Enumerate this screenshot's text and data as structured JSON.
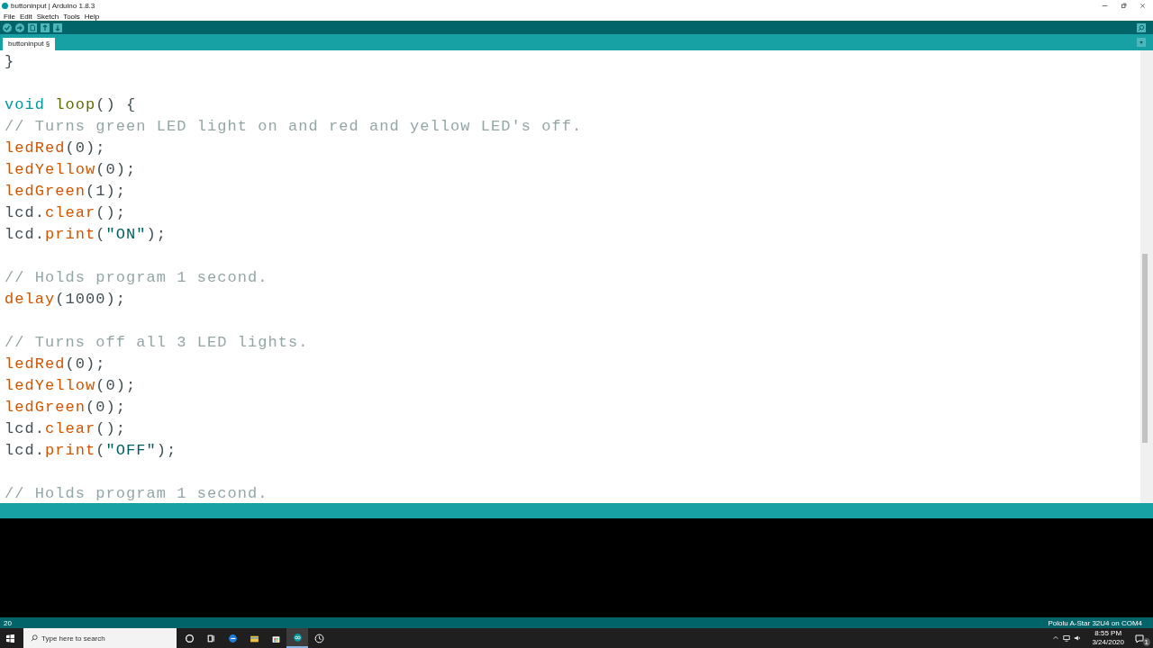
{
  "window": {
    "title": "buttoninput | Arduino 1.8.3"
  },
  "menu": [
    "File",
    "Edit",
    "Sketch",
    "Tools",
    "Help"
  ],
  "toolbar": [
    {
      "kind": "verify"
    },
    {
      "kind": "upload"
    },
    {
      "kind": "new"
    },
    {
      "kind": "open"
    },
    {
      "kind": "save"
    }
  ],
  "tabs": [
    {
      "label": "buttoninput §",
      "selected": true
    }
  ],
  "editor": {
    "lines": [
      {
        "kind": "code",
        "tokens": [
          {
            "text": "}",
            "kind": "plain"
          }
        ]
      },
      {
        "kind": "blank"
      },
      {
        "kind": "code",
        "tokens": [
          {
            "text": "void ",
            "kind": "keyword"
          },
          {
            "text": "loop",
            "kind": "function"
          },
          {
            "text": "() {",
            "kind": "plain"
          }
        ]
      },
      {
        "kind": "code",
        "tokens": [
          {
            "text": "// Turns green LED light on and red and yellow LED's off.",
            "kind": "comment"
          }
        ]
      },
      {
        "kind": "code",
        "tokens": [
          {
            "text": "ledRed",
            "kind": "builtin"
          },
          {
            "text": "(0);",
            "kind": "plain"
          }
        ]
      },
      {
        "kind": "code",
        "tokens": [
          {
            "text": "ledYellow",
            "kind": "builtin"
          },
          {
            "text": "(0);",
            "kind": "plain"
          }
        ]
      },
      {
        "kind": "code",
        "tokens": [
          {
            "text": "ledGreen",
            "kind": "builtin"
          },
          {
            "text": "(1);",
            "kind": "plain"
          }
        ]
      },
      {
        "kind": "code",
        "tokens": [
          {
            "text": "lcd.",
            "kind": "plain"
          },
          {
            "text": "clear",
            "kind": "builtin"
          },
          {
            "text": "();",
            "kind": "plain"
          }
        ]
      },
      {
        "kind": "code",
        "tokens": [
          {
            "text": "lcd.",
            "kind": "plain"
          },
          {
            "text": "print",
            "kind": "builtin"
          },
          {
            "text": "(",
            "kind": "plain"
          },
          {
            "text": "\"ON\"",
            "kind": "string"
          },
          {
            "text": ");",
            "kind": "plain"
          }
        ]
      },
      {
        "kind": "blank"
      },
      {
        "kind": "code",
        "tokens": [
          {
            "text": "// Holds program 1 second.",
            "kind": "comment"
          }
        ]
      },
      {
        "kind": "code",
        "tokens": [
          {
            "text": "delay",
            "kind": "builtin"
          },
          {
            "text": "(1000);",
            "kind": "plain"
          }
        ]
      },
      {
        "kind": "blank"
      },
      {
        "kind": "code",
        "tokens": [
          {
            "text": "// Turns off all 3 LED lights.",
            "kind": "comment"
          }
        ]
      },
      {
        "kind": "code",
        "tokens": [
          {
            "text": "ledRed",
            "kind": "builtin"
          },
          {
            "text": "(0);",
            "kind": "plain"
          }
        ]
      },
      {
        "kind": "code",
        "tokens": [
          {
            "text": "ledYellow",
            "kind": "builtin"
          },
          {
            "text": "(0);",
            "kind": "plain"
          }
        ]
      },
      {
        "kind": "code",
        "tokens": [
          {
            "text": "ledGreen",
            "kind": "builtin"
          },
          {
            "text": "(0);",
            "kind": "plain"
          }
        ]
      },
      {
        "kind": "code",
        "tokens": [
          {
            "text": "lcd.",
            "kind": "plain"
          },
          {
            "text": "clear",
            "kind": "builtin"
          },
          {
            "text": "();",
            "kind": "plain"
          }
        ]
      },
      {
        "kind": "code",
        "tokens": [
          {
            "text": "lcd.",
            "kind": "plain"
          },
          {
            "text": "print",
            "kind": "builtin"
          },
          {
            "text": "(",
            "kind": "plain"
          },
          {
            "text": "\"OFF\"",
            "kind": "string"
          },
          {
            "text": ");",
            "kind": "plain"
          }
        ]
      },
      {
        "kind": "blank"
      },
      {
        "kind": "code",
        "tokens": [
          {
            "text": "// Holds program 1 second.",
            "kind": "comment"
          }
        ]
      }
    ]
  },
  "status_bar": {
    "line": "20",
    "board": "Pololu A-Star 32U4 on COM4"
  },
  "taskbar": {
    "search": {
      "placeholder": "Type here to search"
    },
    "apps": [
      {
        "kind": "cortana",
        "selected": false
      },
      {
        "kind": "taskview",
        "selected": false
      },
      {
        "kind": "edge",
        "selected": false
      },
      {
        "kind": "explorer",
        "selected": false
      },
      {
        "kind": "store",
        "selected": false
      },
      {
        "kind": "arduino",
        "selected": true
      },
      {
        "kind": "clock",
        "selected": false
      }
    ],
    "time": "8:55 PM",
    "date": "3/24/2020",
    "notifications": "1"
  }
}
